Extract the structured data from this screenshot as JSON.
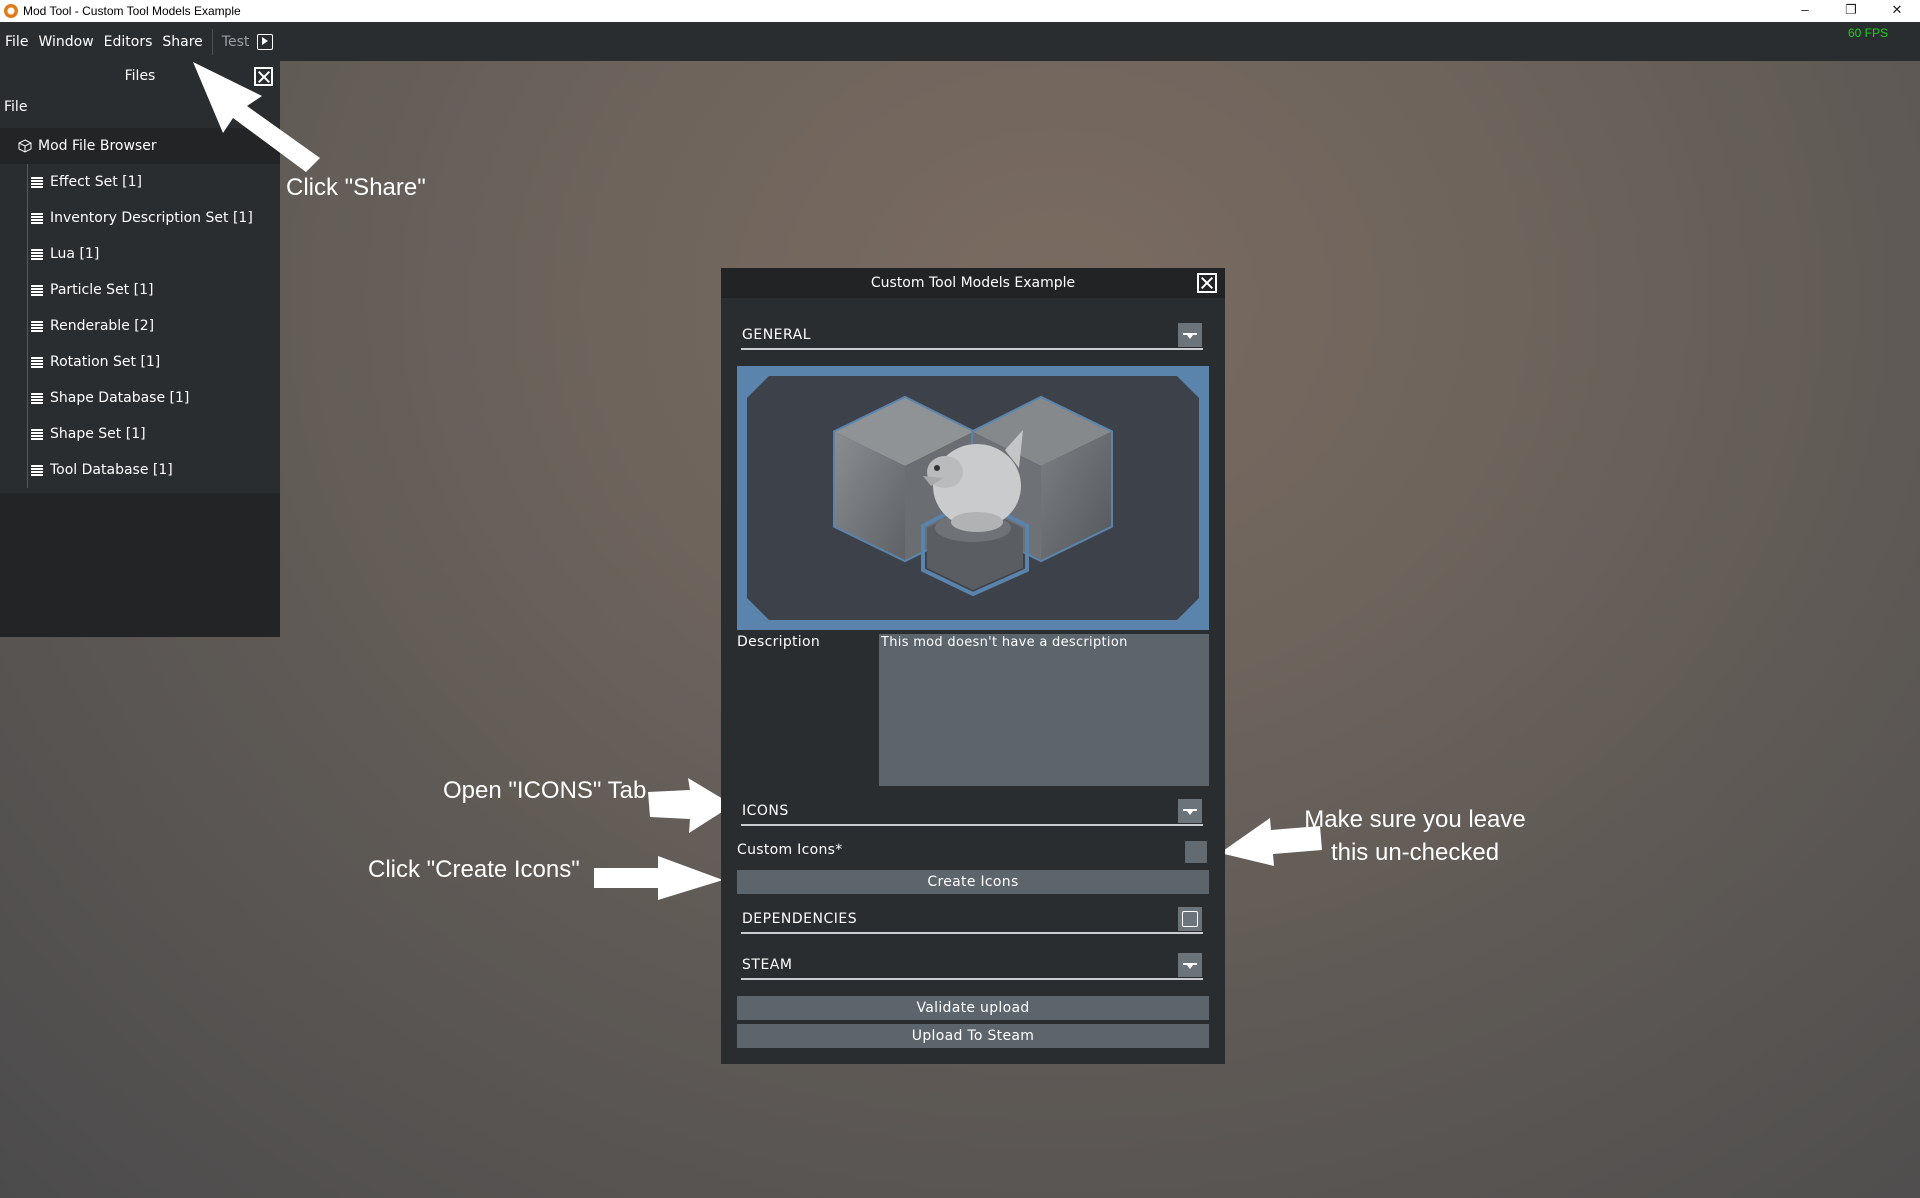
{
  "window": {
    "title": "Mod Tool - Custom Tool Models Example",
    "minimize": "–",
    "restore": "❐",
    "close": "✕"
  },
  "menu": {
    "items": [
      "File",
      "Window",
      "Editors",
      "Share"
    ],
    "test_label": "Test"
  },
  "fps": "60 FPS",
  "files_panel": {
    "title": "Files",
    "sub_menu": "File",
    "browser_title": "Mod File Browser",
    "items": [
      "Effect Set [1]",
      "Inventory Description Set [1]",
      "Lua [1]",
      "Particle Set [1]",
      "Renderable [2]",
      "Rotation Set [1]",
      "Shape Database [1]",
      "Shape Set [1]",
      "Tool Database [1]"
    ]
  },
  "dialog": {
    "title": "Custom Tool Models Example",
    "sections": {
      "general": "GENERAL",
      "icons": "ICONS",
      "dependencies": "DEPENDENCIES",
      "steam": "STEAM"
    },
    "description_label": "Description",
    "description_value": "This mod doesn't have a description",
    "custom_icons_label": "Custom Icons*",
    "custom_icons_checked": false,
    "create_icons": "Create Icons",
    "validate_upload": "Validate upload",
    "upload_to_steam": "Upload To Steam"
  },
  "annotations": {
    "click_share": "Click \"Share\"",
    "open_icons": "Open \"ICONS\" Tab",
    "click_create": "Click \"Create Icons\"",
    "leave_unchecked_line1": "Make sure you leave",
    "leave_unchecked_line2": "this un-checked"
  },
  "colors": {
    "fps": "#18d418",
    "preview_border": "#5b84ad",
    "panel": "#2a2d30"
  }
}
